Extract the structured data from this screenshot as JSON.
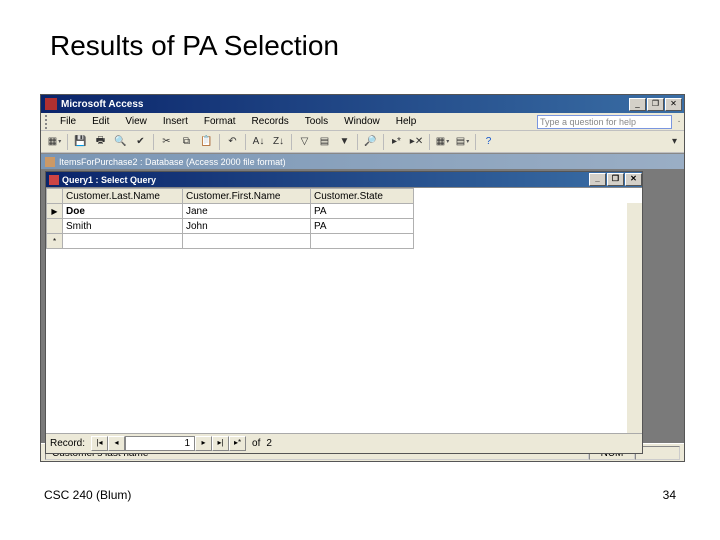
{
  "slide": {
    "title": "Results of PA Selection",
    "footer_left": "CSC 240 (Blum)",
    "page_number": "34"
  },
  "app": {
    "title": "Microsoft Access",
    "help_placeholder": "Type a question for help",
    "menus": [
      "File",
      "Edit",
      "View",
      "Insert",
      "Format",
      "Records",
      "Tools",
      "Window",
      "Help"
    ],
    "db_window_title": "ItemsForPurchase2 : Database (Access 2000 file format)",
    "child_title": "Query1 : Select Query",
    "status_text": "Customer's last name",
    "status_indicator": "NUM"
  },
  "grid": {
    "columns": [
      "Customer.Last.Name",
      "Customer.First.Name",
      "Customer.State"
    ],
    "rows": [
      {
        "selector": "▶",
        "c0": "Doe",
        "c1": "Jane",
        "c2": "PA"
      },
      {
        "selector": "",
        "c0": "Smith",
        "c1": "John",
        "c2": "PA"
      },
      {
        "selector": "*",
        "c0": "",
        "c1": "",
        "c2": ""
      }
    ]
  },
  "record_nav": {
    "label": "Record:",
    "current": "1",
    "of_label": "of",
    "total": "2"
  },
  "chart_data": {
    "type": "table",
    "title": "Query1 : Select Query",
    "columns": [
      "Customer.Last.Name",
      "Customer.First.Name",
      "Customer.State"
    ],
    "rows": [
      [
        "Doe",
        "Jane",
        "PA"
      ],
      [
        "Smith",
        "John",
        "PA"
      ]
    ]
  }
}
